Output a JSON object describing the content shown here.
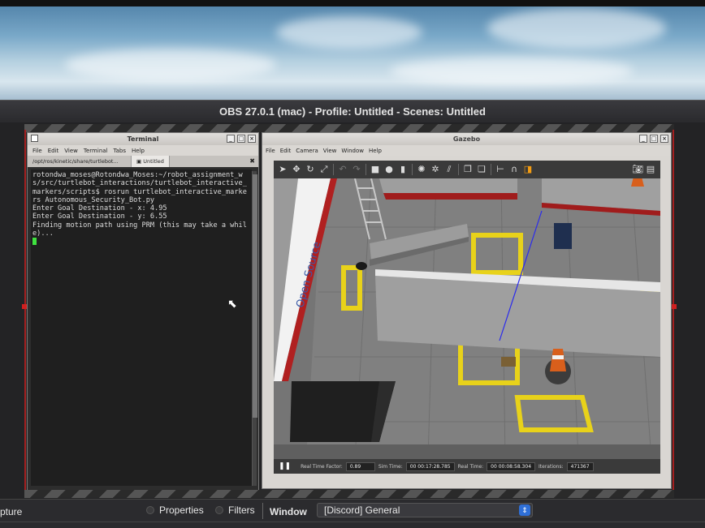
{
  "obs": {
    "title": "OBS 27.0.1 (mac) - Profile: Untitled - Scenes: Untitled",
    "dock": {
      "source_name": "pture",
      "properties_label": "Properties",
      "filters_label": "Filters",
      "window_label": "Window",
      "window_value": "[Discord] General"
    }
  },
  "terminal": {
    "title": "Terminal",
    "menu": [
      "File",
      "Edit",
      "View",
      "Terminal",
      "Tabs",
      "Help"
    ],
    "tabs": [
      "/opt/ros/kinetic/share/turtlebot...",
      "Untitled"
    ],
    "lines": "rotondwa_moses@Rotondwa_Moses:~/robot_assignment_ws/src/turtlebot_interactions/turtlebot_interactive_markers/scripts$ rosrun turtlebot_interactive_markers Autonomous_Security_Bot.py\nEnter Goal Destination - x: 4.95\nEnter Goal Destination - y: 6.55\nFinding motion path using PRM (this may take a while)...\n"
  },
  "gazebo": {
    "title": "Gazebo",
    "menu": [
      "File",
      "Edit",
      "Camera",
      "View",
      "Window",
      "Help"
    ],
    "status": {
      "rtf_label": "Real Time Factor:",
      "rtf_value": "0.89",
      "sim_time_label": "Sim Time:",
      "sim_time_value": "00 00:17:28.785",
      "real_time_label": "Real Time:",
      "real_time_value": "00 00:08:58.304",
      "iterations_label": "Iterations:",
      "iterations_value": "471367"
    },
    "sign_text": "Open Source"
  }
}
